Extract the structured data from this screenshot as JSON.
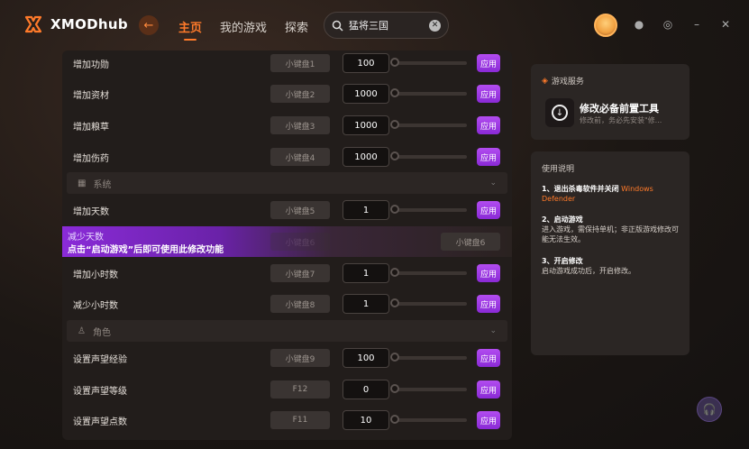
{
  "app": {
    "name": "XMODhub"
  },
  "nav": {
    "items": [
      "主页",
      "我的游戏",
      "探索"
    ],
    "active": 0
  },
  "search": {
    "value": "猛将三国"
  },
  "rows": [
    {
      "label": "增加功勋",
      "hotkey": "小键盘1",
      "value": "100",
      "apply": "应用"
    },
    {
      "label": "增加资材",
      "hotkey": "小键盘2",
      "value": "1000",
      "apply": "应用"
    },
    {
      "label": "增加粮草",
      "hotkey": "小键盘3",
      "value": "1000",
      "apply": "应用"
    },
    {
      "label": "增加伤药",
      "hotkey": "小键盘4",
      "value": "1000",
      "apply": "应用"
    }
  ],
  "section_system": {
    "label": "系统"
  },
  "rows_system": [
    {
      "label": "增加天数",
      "hotkey": "小键盘5",
      "value": "1",
      "apply": "应用"
    }
  ],
  "highlight_row": {
    "label": "减少天数",
    "notice": "点击“启动游戏”后即可使用此修改功能",
    "hotkey_dim": "小键盘6",
    "hotkey": "小键盘6"
  },
  "rows_system2": [
    {
      "label": "增加小时数",
      "hotkey": "小键盘7",
      "value": "1",
      "apply": "应用"
    },
    {
      "label": "减少小时数",
      "hotkey": "小键盘8",
      "value": "1",
      "apply": "应用"
    }
  ],
  "section_role": {
    "label": "角色"
  },
  "rows_role": [
    {
      "label": "设置声望经验",
      "hotkey": "小键盘9",
      "value": "100",
      "apply": "应用"
    },
    {
      "label": "设置声望等级",
      "hotkey": "F12",
      "value": "0",
      "apply": "应用"
    },
    {
      "label": "设置声望点数",
      "hotkey": "F11",
      "value": "10",
      "apply": "应用"
    }
  ],
  "service_card": {
    "title": "游戏服务",
    "tool_title": "修改必备前置工具",
    "tool_sub": "修改前，务必先安装\"修..."
  },
  "instructions": {
    "title": "使用说明",
    "step1_title": "1、退出杀毒软件并关闭",
    "step1_accent": "Windows Defender",
    "step2_title": "2、启动游戏",
    "step2_body": "进入游戏，需保持单机；非正版游戏修改可能无法生效。",
    "step3_title": "3、开启修改",
    "step3_body": "启动游戏成功后，开启修改。"
  },
  "colors": {
    "accent": "#ff7a2a",
    "apply": "#a13ee6"
  }
}
